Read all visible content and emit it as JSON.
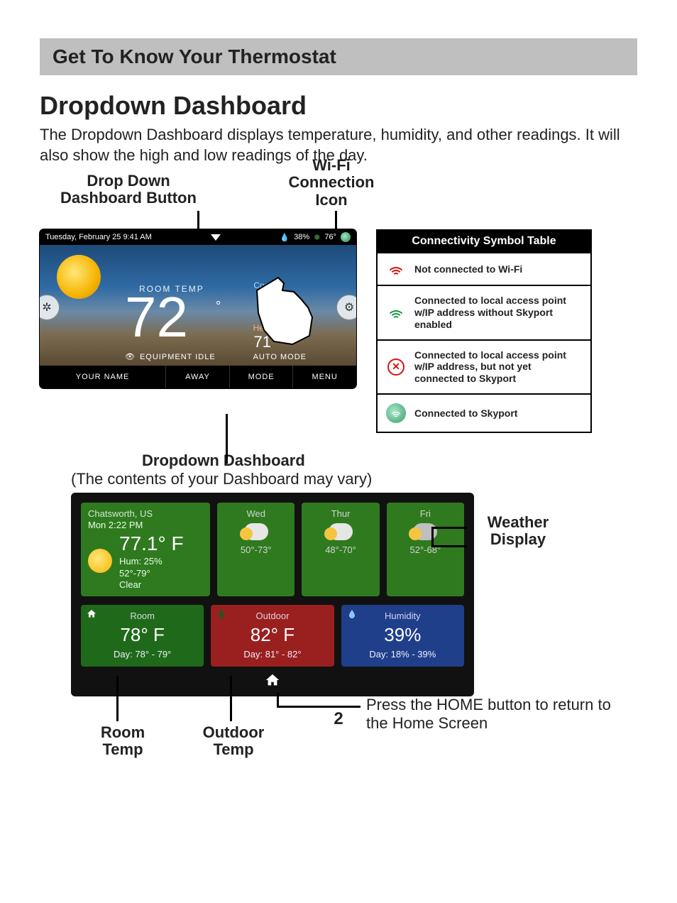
{
  "banner": "Get To Know Your Thermostat",
  "section_title": "Dropdown Dashboard",
  "lead": "The Dropdown Dashboard displays temperature, humidity, and other readings.  It will also show the high and low readings of the day.",
  "callouts": {
    "dd_button": "Drop Down\nDashboard Button",
    "wifi_icon": "Wi-Fi\nConnection\nIcon",
    "dd_title": "Dropdown Dashboard",
    "dd_sub": "(The contents of your Dashboard may vary)",
    "weather_display": "Weather\nDisplay",
    "room_temp": "Room\nTemp",
    "outdoor_temp": "Outdoor\nTemp",
    "home_note": "Press the HOME button to return to the Home Screen"
  },
  "thermo": {
    "datetime": "Tuesday, February 25 9:41 AM",
    "humidity_pct": "38%",
    "outdoor_small": "76°",
    "room_label": "ROOM TEMP",
    "room_temp": "72",
    "cool_label": "Cool",
    "heat_label": "Heat",
    "heat_setpoint": "71",
    "equipment": "EQUIPMENT IDLE",
    "auto_mode": "AUTO MODE",
    "bottom": {
      "name": "YOUR NAME",
      "away": "AWAY",
      "mode": "MODE",
      "menu": "MENU"
    }
  },
  "connectivity": {
    "header": "Connectivity Symbol Table",
    "rows": [
      "Not connected to Wi-Fi",
      "Connected to local access point w/IP address without Skyport enabled",
      "Connected to local access point w/IP address, but not yet connected to Skyport",
      "Connected to Skyport"
    ]
  },
  "dashboard": {
    "city": "Chatsworth, US",
    "now_time": "Mon 2:22 PM",
    "now_temp": "77.1° F",
    "now_hum": "Hum: 25%",
    "now_range": "52°-79°",
    "now_cond": "Clear",
    "forecast": [
      {
        "day": "Wed",
        "range": "50°-73°"
      },
      {
        "day": "Thur",
        "range": "48°-70°"
      },
      {
        "day": "Fri",
        "range": "52°-68°"
      }
    ],
    "tiles": {
      "room": {
        "label": "Room",
        "value": "78° F",
        "range": "Day: 78° - 79°"
      },
      "outdoor": {
        "label": "Outdoor",
        "value": "82° F",
        "range": "Day: 81° - 82°"
      },
      "humidity": {
        "label": "Humidity",
        "value": "39%",
        "range": "Day: 18% - 39%"
      }
    }
  },
  "page_number": "2"
}
